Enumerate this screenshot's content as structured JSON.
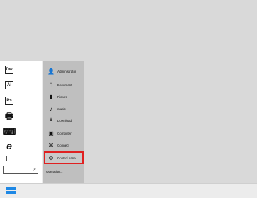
{
  "left_apps": [
    {
      "name": "dreamweaver-icon",
      "label": "Dw"
    },
    {
      "name": "illustrator-icon",
      "label": "Ai"
    },
    {
      "name": "photoshop-icon",
      "label": "Ps"
    },
    {
      "name": "printer-icon",
      "label": "🖶"
    },
    {
      "name": "keyboard-icon",
      "label": "⌨"
    },
    {
      "name": "edge-icon",
      "label": "e"
    },
    {
      "name": "text-cursor-icon",
      "label": "I"
    }
  ],
  "menu_items": [
    {
      "icon": "administrator-icon",
      "glyph": "👤",
      "label": "Administrator"
    },
    {
      "icon": "document-icon",
      "glyph": "▯",
      "label": "Document"
    },
    {
      "icon": "picture-icon",
      "glyph": "▮",
      "label": "Picture"
    },
    {
      "icon": "music-icon",
      "glyph": "♪",
      "label": "music"
    },
    {
      "icon": "download-icon",
      "glyph": "⭳",
      "label": "Download"
    },
    {
      "icon": "computer-icon",
      "glyph": "▣",
      "label": "Computer"
    },
    {
      "icon": "connect-icon",
      "glyph": "⌘",
      "label": "Connect"
    },
    {
      "icon": "control-panel-icon",
      "glyph": "⚙",
      "label": "Control panel"
    }
  ],
  "operation_label": "Operation...",
  "search": {
    "placeholder": ""
  },
  "colors": {
    "highlight": "#e02020",
    "start_blue": "#1e88e5"
  }
}
